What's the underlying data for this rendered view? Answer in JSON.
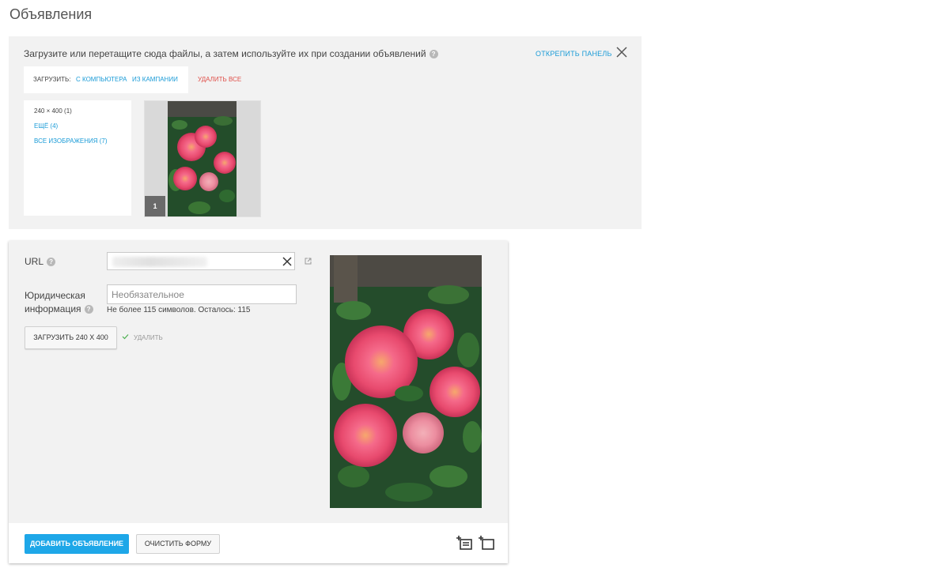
{
  "page": {
    "title": "Объявления"
  },
  "upload_panel": {
    "hint": "Загрузите или перетащите сюда файлы, а затем используйте их при создании объявлений",
    "help_icon": "question-icon",
    "unpin_label": "ОТКРЕПИТЬ ПАНЕЛЬ",
    "close_icon": "close-icon",
    "upload_label": "ЗАГРУЗИТЬ:",
    "from_computer": "С КОМПЬЮТЕРА",
    "from_campaign": "ИЗ КАМПАНИИ",
    "delete_all": "УДАЛИТЬ ВСЕ",
    "filters": {
      "size": "240 × 400 (1)",
      "more": "ЕЩЁ (4)",
      "all": "ВСЕ ИЗОБРАЖЕНИЯ (7)"
    },
    "thumbnails": [
      {
        "badge": "1"
      }
    ]
  },
  "form": {
    "url_label": "URL",
    "legal_label_line1": "Юридическая",
    "legal_label_line2": "информация",
    "legal_placeholder": "Необязательное",
    "char_hint": "Не более 115 символов. Осталось: 115",
    "upload_button": "ЗАГРУЗИТЬ 240 X 400",
    "delete_label": "УДАЛИТЬ",
    "add_button": "ДОБАВИТЬ ОБЪЯВЛЕНИЕ",
    "clear_button": "ОЧИСТИТЬ ФОРМУ"
  },
  "colors": {
    "accent": "#1ea7e8",
    "link": "#1a9bd7",
    "danger": "#e0504a",
    "panel_bg": "#f2f2f2"
  }
}
